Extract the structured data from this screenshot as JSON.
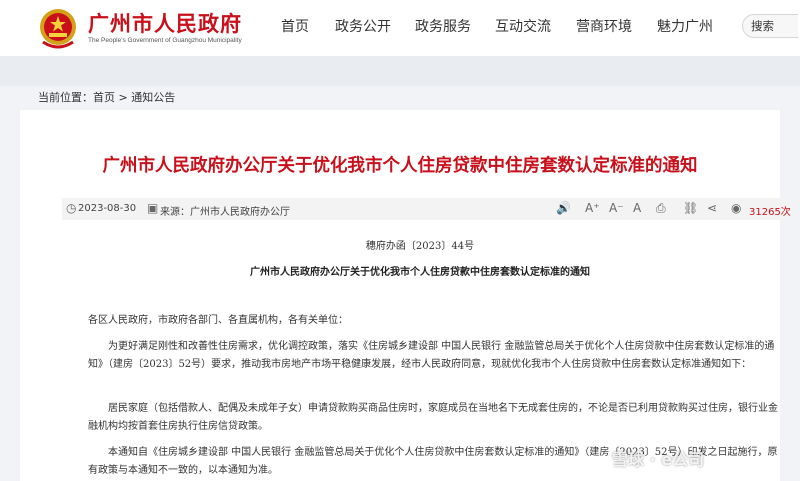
{
  "header": {
    "site_name": "广州市人民政府",
    "site_sub": "The People's Government of Guangzhou Municipality",
    "nav": [
      "首页",
      "政务公开",
      "政务服务",
      "互动交流",
      "营商环境",
      "魅力广州"
    ],
    "search_label": "搜索"
  },
  "breadcrumb": {
    "prefix": "当前位置：",
    "home": "首页",
    "sep": " > ",
    "current": "通知公告"
  },
  "article": {
    "title": "广州市人民政府办公厅关于优化我市个人住房贷款中住房套数认定标准的通知",
    "date": "2023-08-30",
    "source": "来源：广州市人民政府办公厅",
    "views": "31265次",
    "doc_number": "穗府办函〔2023〕44号",
    "subtitle": "广州市人民政府办公厅关于优化我市个人住房贷款中住房套数认定标准的通知",
    "paragraphs": [
      "各区人民政府，市政府各部门、各直属机构，各有关单位：",
      "为更好满足刚性和改善性住房需求，优化调控政策，落实《住房城乡建设部 中国人民银行 金融监管总局关于优化个人住房贷款中住房套数认定标准的通知》（建房〔2023〕52号）要求，推动我市房地产市场平稳健康发展，经市人民政府同意，现就优化我市个人住房贷款中住房套数认定标准通知如下：",
      "居民家庭（包括借款人、配偶及未成年子女）申请贷款购买商品住房时，家庭成员在当地名下无成套住房的，不论是否已利用贷款购买过住房，银行业金融机构均按首套住房执行住房信贷政策。",
      "本通知自《住房城乡建设部 中国人民银行 金融监管总局关于优化个人住房贷款中住房套数认定标准的通知》（建房〔2023〕52号）印发之日起施行，原有政策与本通知不一致的，以本通知为准。"
    ]
  },
  "watermark": "雪球 · e公司",
  "colors": {
    "brand_red": "#c9101a"
  },
  "icons": [
    "emblem-icon",
    "calendar-icon",
    "source-icon",
    "audio-icon",
    "font-increase-icon",
    "font-decrease-icon",
    "font-default-icon",
    "print-icon",
    "share-icon",
    "link-icon",
    "eye-icon"
  ]
}
